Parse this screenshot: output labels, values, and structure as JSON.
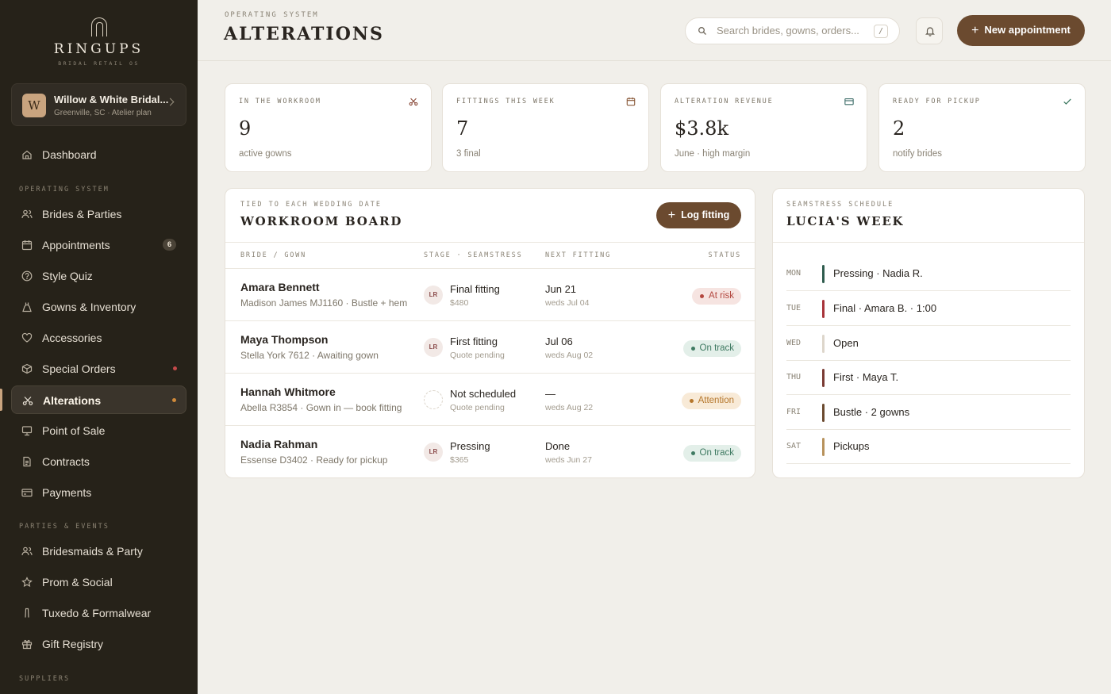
{
  "brand": {
    "name": "RINGUPS",
    "tagline": "BRIDAL RETAIL OS"
  },
  "store": {
    "initial": "W",
    "name": "Willow & White Bridal...",
    "meta": "Greenville, SC · Atelier plan"
  },
  "sidebar": {
    "dashboard": "Dashboard",
    "section_operating": "OPERATING SYSTEM",
    "brides": "Brides & Parties",
    "appointments": "Appointments",
    "appointments_badge": "6",
    "style_quiz": "Style Quiz",
    "gowns": "Gowns & Inventory",
    "accessories": "Accessories",
    "special_orders": "Special Orders",
    "alterations": "Alterations",
    "pos": "Point of Sale",
    "contracts": "Contracts",
    "payments": "Payments",
    "section_parties": "PARTIES & EVENTS",
    "bridesmaids": "Bridesmaids & Party",
    "prom": "Prom & Social",
    "tuxedo": "Tuxedo & Formalwear",
    "gift_registry": "Gift Registry",
    "section_suppliers": "SUPPLIERS"
  },
  "header": {
    "eyebrow": "OPERATING SYSTEM",
    "title": "ALTERATIONS",
    "search_placeholder": "Search brides, gowns, orders...",
    "search_shortcut": "/",
    "new_button": "New appointment"
  },
  "stats": [
    {
      "label": "IN THE WORKROOM",
      "value": "9",
      "sub": "active gowns",
      "icon": "scissors-icon"
    },
    {
      "label": "FITTINGS THIS WEEK",
      "value": "7",
      "sub": "3 final",
      "icon": "calendar-icon"
    },
    {
      "label": "ALTERATION REVENUE",
      "value": "$3.8k",
      "sub": "June · high margin",
      "icon": "card-icon"
    },
    {
      "label": "READY FOR PICKUP",
      "value": "2",
      "sub": "notify brides",
      "icon": "check-icon"
    }
  ],
  "board": {
    "eyebrow": "TIED TO EACH WEDDING DATE",
    "title": "WORKROOM BOARD",
    "log_button": "Log fitting",
    "columns": {
      "bride": "BRIDE / GOWN",
      "stage": "STAGE · SEAMSTRESS",
      "next": "NEXT FITTING",
      "status": "STATUS"
    },
    "rows": [
      {
        "name": "Amara Bennett",
        "gown": "Madison James MJ1160 · Bustle + hem",
        "initials": "LR",
        "stage": "Final fitting",
        "stage_sub": "$480",
        "next": "Jun 21",
        "next_sub": "weds Jul 04",
        "status": "At risk"
      },
      {
        "name": "Maya Thompson",
        "gown": "Stella York 7612 · Awaiting gown",
        "initials": "LR",
        "stage": "First fitting",
        "stage_sub": "Quote pending",
        "next": "Jul 06",
        "next_sub": "weds Aug 02",
        "status": "On track"
      },
      {
        "name": "Hannah Whitmore",
        "gown": "Abella R3854 · Gown in — book fitting",
        "initials": "",
        "stage": "Not scheduled",
        "stage_sub": "Quote pending",
        "next": "—",
        "next_sub": "weds Aug 22",
        "status": "Attention"
      },
      {
        "name": "Nadia Rahman",
        "gown": "Essense D3402 · Ready for pickup",
        "initials": "LR",
        "stage": "Pressing",
        "stage_sub": "$365",
        "next": "Done",
        "next_sub": "weds Jun 27",
        "status": "On track"
      }
    ]
  },
  "schedule": {
    "eyebrow": "SEAMSTRESS SCHEDULE",
    "title": "LUCIA'S WEEK",
    "days": [
      {
        "day": "MON",
        "text": "Pressing · Nadia R."
      },
      {
        "day": "TUE",
        "text": "Final · Amara B. · 1:00"
      },
      {
        "day": "WED",
        "text": "Open"
      },
      {
        "day": "THU",
        "text": "First · Maya T."
      },
      {
        "day": "FRI",
        "text": "Bustle · 2 gowns"
      },
      {
        "day": "SAT",
        "text": "Pickups"
      }
    ]
  },
  "colors": {
    "accent": "#6b4a2f",
    "sidebar_bg": "#262219",
    "at_risk": "#b3473f",
    "on_track": "#3f7a62",
    "attention": "#b5772c",
    "day_mon": "#2f5c4e",
    "day_tue": "#a8343a",
    "day_wed": "#ddd6cb",
    "day_thu": "#7a3b34",
    "day_fri": "#6b4a2f",
    "day_sat": "#b8925c"
  }
}
